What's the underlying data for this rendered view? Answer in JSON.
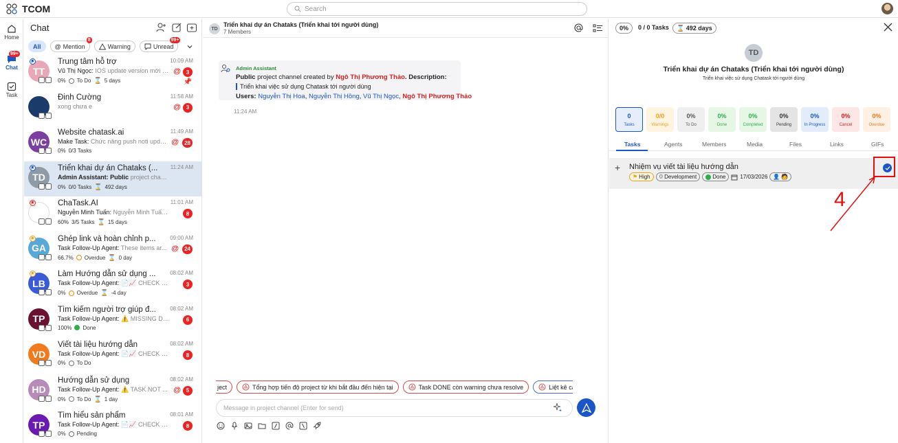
{
  "app": {
    "title": "TCOM",
    "search_placeholder": "Search"
  },
  "rail": [
    {
      "label": "Home",
      "icon": "home-icon"
    },
    {
      "label": "Chat",
      "icon": "chat-icon",
      "badge": "99+"
    },
    {
      "label": "Task",
      "icon": "task-icon"
    }
  ],
  "chatlist": {
    "title": "Chat",
    "filters": {
      "all": "All",
      "mention": "Mention",
      "mention_badge": "8",
      "warning": "Warning",
      "unread": "Unread",
      "unread_badge": "99+"
    },
    "items": [
      {
        "initials": "TT",
        "color": "#e8a8b8",
        "name": "Trung tâm hỗ trợ",
        "time": "10:09 AM",
        "sender": "Vũ Thị Ngọc:",
        "preview": " IOS update version mới tr...",
        "pct": "0%",
        "status": "To Do",
        "days": "5 days",
        "count": "3",
        "mention": true
      },
      {
        "initials": "",
        "color": "#1b3b6b",
        "name": "Đinh Cường",
        "time": "11:58 AM",
        "sender": "",
        "preview": "xong chưa e",
        "count": "3",
        "mention": true
      },
      {
        "initials": "WC",
        "color": "#7a3fa0",
        "name": "Website chatask.ai",
        "time": "11:49 AM",
        "sender": "Make Task:",
        "preview": " Chức năng push noti updat...",
        "pct": "0%",
        "tasks": "0/3 Tasks",
        "count": "28",
        "mention": true
      },
      {
        "initials": "TD",
        "color": "#8e9aa5",
        "name": "Triển khai dự án Chataks (...",
        "time": "11:24 AM",
        "sender": "Admin Assistant: Public",
        "preview": " project channel creat...",
        "pct": "0%",
        "tasks": "0/0 Tasks",
        "days": "492 days"
      },
      {
        "initials": "",
        "color": "#ffffff",
        "name": "ChaTask.AI",
        "time": "11:01 AM",
        "sender": "Nguyễn Minh Tuấn:",
        "preview": " Nguyễn Minh Tuấn up...",
        "pct": "60%",
        "tasks": "3/5 Tasks",
        "days": "15 days",
        "count": "8"
      },
      {
        "initials": "GA",
        "color": "#58a8d8",
        "name": "Ghép link và hoàn chỉnh p...",
        "time": "09:00 AM",
        "sender": "Task Follow-Up Agent:",
        "preview": " These items ar...",
        "pct": "66.7%",
        "status": "Overdue",
        "days": "0 day",
        "count": "24",
        "mention": true
      },
      {
        "initials": "LB",
        "color": "#3a5ad8",
        "name": "Làm Hướng dẫn sử dụng ...",
        "time": "08:02 AM",
        "sender": "Task Follow-Up Agent:",
        "preview": " 📄📈 CHECK PR...",
        "pct": "0%",
        "status": "Overdue",
        "days": "-4 day",
        "count": "3"
      },
      {
        "initials": "TP",
        "color": "#6a1030",
        "name": "Tìm kiếm người trợ giúp đ...",
        "time": "08:02 AM",
        "sender": "Task Follow-Up Agent:",
        "preview": " ⚠️ MISSING DAT...",
        "pct": "100%",
        "status": "Done",
        "count": "6"
      },
      {
        "initials": "VD",
        "color": "#f07a20",
        "name": "Viết tài liệu hướng dẫn",
        "time": "08:02 AM",
        "sender": "Task Follow-Up Agent:",
        "preview": " 📄📈 CHECK PR...",
        "pct": "0%",
        "status": "To Do",
        "count": "8"
      },
      {
        "initials": "HD",
        "color": "#b88ab8",
        "name": "Hướng dẫn sử dụng",
        "time": "08:02 AM",
        "sender": "Task Follow-Up Agent:",
        "preview": " ⚠️ TASK NOT ...",
        "pct": "0%",
        "status": "To Do",
        "days": "1 day",
        "count": "5",
        "mention": true
      },
      {
        "initials": "TP",
        "color": "#6a1ab0",
        "name": "Tìm hiểu sản phẩm",
        "time": "08:01 AM",
        "sender": "Task Follow-Up Agent:",
        "preview": " 📄📈 CHECK PR...",
        "pct": "0%",
        "status": "Pending",
        "count": "8"
      }
    ]
  },
  "channel": {
    "initials": "TD",
    "title": "Triển khai dự án Chataks (Triển khai tới người dùng)",
    "members": "7 Members",
    "message": {
      "sender": "Admin Assistant",
      "l1_a": "Public",
      "l1_b": " project channel created by ",
      "l1_creator": "Ngô Thị Phương Thảo",
      "l1_c": ". Description:",
      "quote": "Triển khai việc sử dụng Chatask tới người dùng",
      "users_label": "Users: ",
      "users": [
        "Nguyễn Thị Hoa",
        "Nguyễn Thị Hồng",
        "Vũ Thị Ngọc"
      ],
      "users_last": "Ngô Thị Phương Thảo",
      "time": "11:24 AM"
    },
    "prompts": [
      "ject",
      "Tổng hợp tiến độ project từ khi bắt đầu đến hiện tại",
      "Task DONE còn warning chưa resolve",
      "Liệt kê các ta"
    ],
    "composer_placeholder": "Message in project channel (Enter for send)"
  },
  "detail": {
    "pct": "0%",
    "tasks": "0 / 0 Tasks",
    "days": "492 days",
    "initials": "TD",
    "title": "Triển khai dự án Chataks (Triển khai tới người dùng)",
    "desc": "Triển khai việc sử dụng Chatask tới người dùng",
    "stats": [
      {
        "v": "0",
        "l": "Tasks",
        "bg": "#e6eefb",
        "fg": "#1a56c8",
        "border": "#1a56c8"
      },
      {
        "v": "0/0",
        "l": "Warnings",
        "bg": "#fff4df",
        "fg": "#f0a020",
        "border": "#fff4df"
      },
      {
        "v": "0%",
        "l": "To Do",
        "bg": "#efefef",
        "fg": "#555",
        "border": "#efefef"
      },
      {
        "v": "0%",
        "l": "Done",
        "bg": "#e6f7e6",
        "fg": "#2eae4d",
        "border": "#e6f7e6"
      },
      {
        "v": "0%",
        "l": "Completed",
        "bg": "#e6f7e6",
        "fg": "#2eae4d",
        "border": "#e6f7e6"
      },
      {
        "v": "0%",
        "l": "Pending",
        "bg": "#e4e4e4",
        "fg": "#333",
        "border": "#e4e4e4"
      },
      {
        "v": "0%",
        "l": "In Progress",
        "bg": "#e3ecfb",
        "fg": "#1a56c8",
        "border": "#e3ecfb"
      },
      {
        "v": "0%",
        "l": "Cancel",
        "bg": "#fde6e6",
        "fg": "#d42020",
        "border": "#fde6e6"
      },
      {
        "v": "0%",
        "l": "Overdue",
        "bg": "#fff0e4",
        "fg": "#f07a20",
        "border": "#fff0e4"
      }
    ],
    "tabs": [
      "Tasks",
      "Agents",
      "Members",
      "Media",
      "Files",
      "Links",
      "GIFs"
    ],
    "task": {
      "title": "Nhiệm vụ viết tài liệu hướng dẫn",
      "priority": "High",
      "category": "Development",
      "status": "Done",
      "date": "17/03/2026"
    }
  },
  "annotation": {
    "number": "4"
  }
}
